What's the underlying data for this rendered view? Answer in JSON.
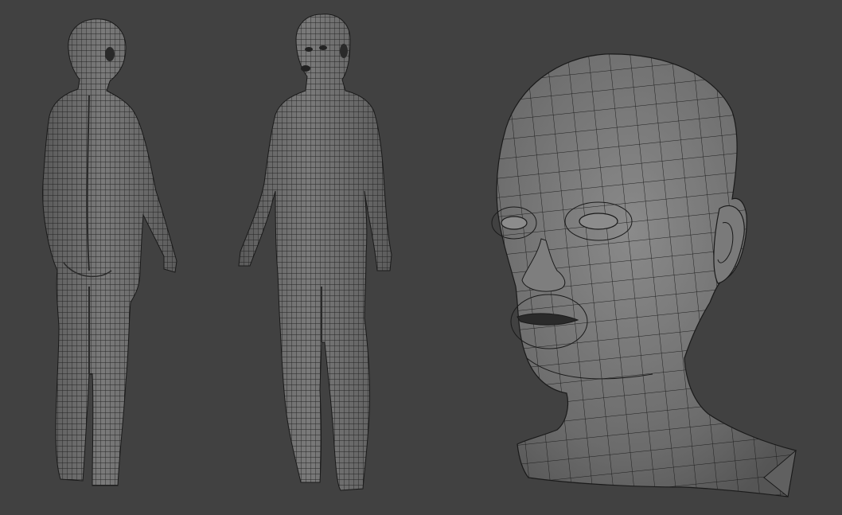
{
  "viewport": {
    "background": "#414141",
    "mesh_fill": "#6e6e6e",
    "mesh_fill_light": "#8a8a8a",
    "wire_color": "#1a1a1a"
  },
  "models": [
    {
      "id": "figure-back-view",
      "icon": "human-figure-back-wireframe"
    },
    {
      "id": "figure-front-view",
      "icon": "human-figure-front-wireframe"
    },
    {
      "id": "head-closeup",
      "icon": "human-head-wireframe"
    }
  ]
}
